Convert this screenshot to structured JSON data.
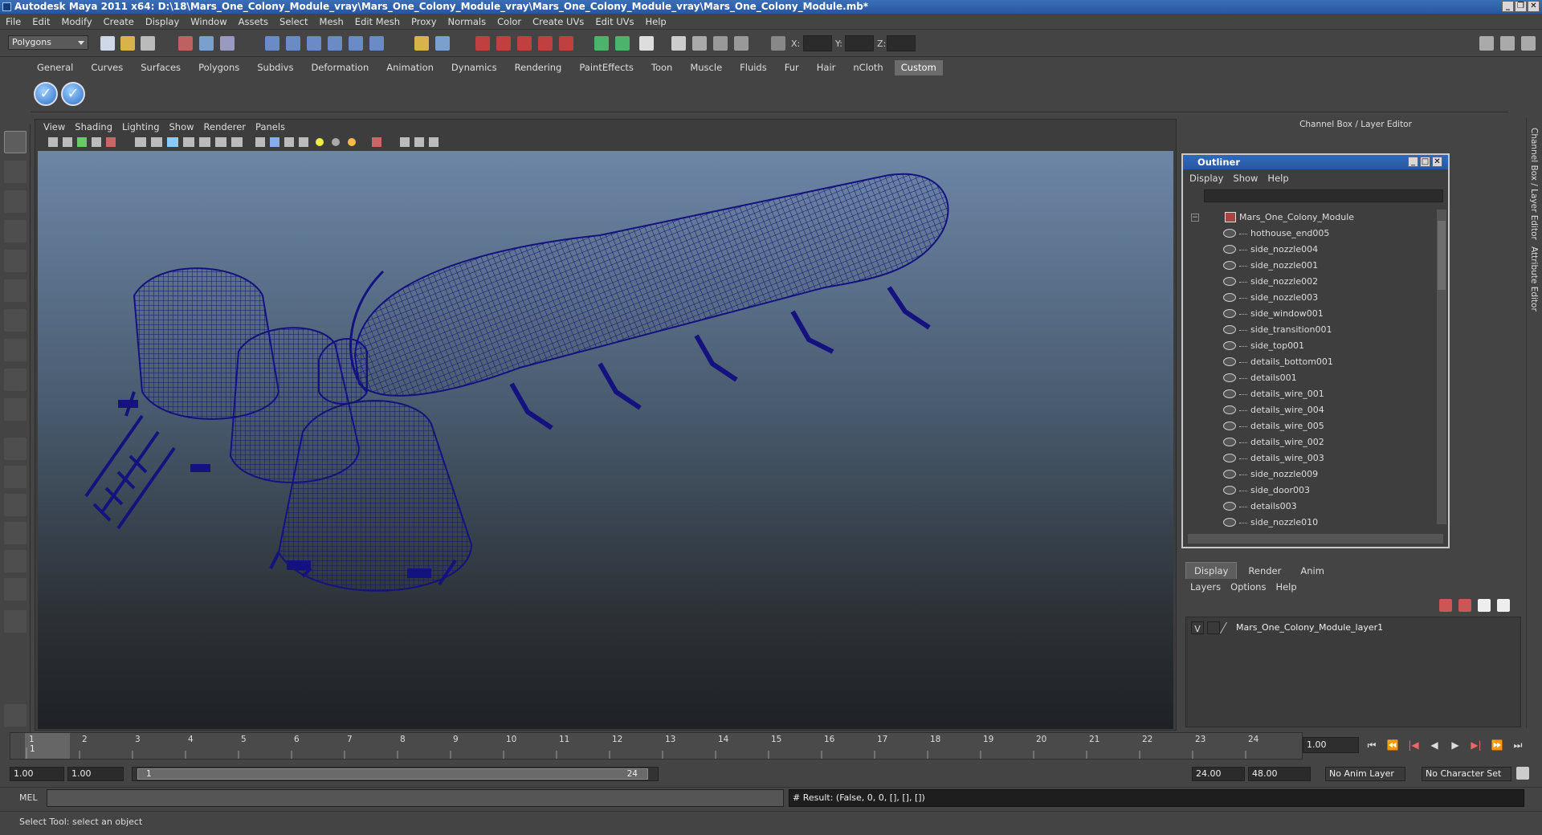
{
  "window": {
    "title": "Autodesk Maya 2011 x64: D:\\18\\Mars_One_Colony_Module_vray\\Mars_One_Colony_Module_vray\\Mars_One_Colony_Module_vray\\Mars_One_Colony_Module.mb*"
  },
  "menubar": [
    "File",
    "Edit",
    "Modify",
    "Create",
    "Display",
    "Window",
    "Assets",
    "Select",
    "Mesh",
    "Edit Mesh",
    "Proxy",
    "Normals",
    "Color",
    "Create UVs",
    "Edit UVs",
    "Help"
  ],
  "status": {
    "mode": "Polygons",
    "x_label": "X:",
    "y_label": "Y:",
    "z_label": "Z:"
  },
  "shelf": {
    "tabs": [
      "General",
      "Curves",
      "Surfaces",
      "Polygons",
      "Subdivs",
      "Deformation",
      "Animation",
      "Dynamics",
      "Rendering",
      "PaintEffects",
      "Toon",
      "Muscle",
      "Fluids",
      "Fur",
      "Hair",
      "nCloth",
      "Custom"
    ],
    "active": "Custom"
  },
  "viewport": {
    "menus": [
      "View",
      "Shading",
      "Lighting",
      "Show",
      "Renderer",
      "Panels"
    ],
    "wire_color": "#14127e"
  },
  "channel_box": {
    "title": "Channel Box / Layer Editor"
  },
  "outliner": {
    "title": "Outliner",
    "menus": [
      "Display",
      "Show",
      "Help"
    ],
    "root": "Mars_One_Colony_Module",
    "items": [
      "hothouse_end005",
      "side_nozzle004",
      "side_nozzle001",
      "side_nozzle002",
      "side_nozzle003",
      "side_window001",
      "side_transition001",
      "side_top001",
      "details_bottom001",
      "details001",
      "details_wire_001",
      "details_wire_004",
      "details_wire_005",
      "details_wire_002",
      "details_wire_003",
      "side_nozzle009",
      "side_door003",
      "details003",
      "side_nozzle010"
    ]
  },
  "layer_editor": {
    "tabs": [
      "Display",
      "Render",
      "Anim"
    ],
    "active": "Display",
    "menus": [
      "Layers",
      "Options",
      "Help"
    ],
    "layer": {
      "vis": "V",
      "name": "Mars_One_Colony_Module_layer1"
    }
  },
  "side_labels": {
    "channel": "Channel Box / Layer Editor",
    "attribute": "Attribute Editor"
  },
  "timeline": {
    "ticks": [
      "1",
      "2",
      "3",
      "4",
      "5",
      "6",
      "7",
      "8",
      "9",
      "10",
      "11",
      "12",
      "13",
      "14",
      "15",
      "16",
      "17",
      "18",
      "19",
      "20",
      "21",
      "22",
      "23",
      "24"
    ],
    "current_frame": "1.00",
    "playhead_label": "1"
  },
  "range": {
    "start": "1.00",
    "inner_start": "1.00",
    "slider_start": "1",
    "slider_end": "24",
    "inner_end": "24.00",
    "end": "48.00",
    "anim_layer": "No Anim Layer",
    "char_set": "No Character Set"
  },
  "cmd": {
    "label": "MEL",
    "result": "# Result: (False, 0, 0, [], [], [])"
  },
  "help": {
    "text": "Select Tool: select an object"
  }
}
